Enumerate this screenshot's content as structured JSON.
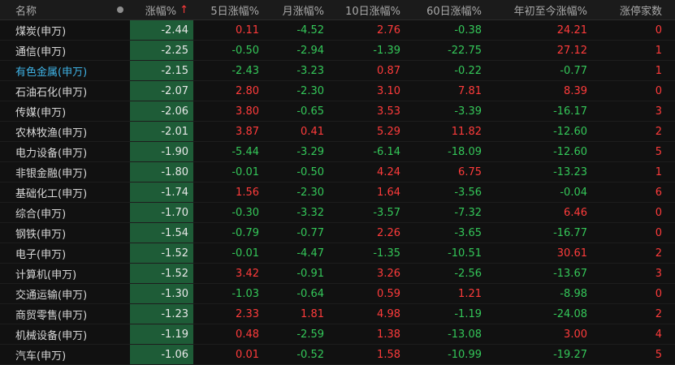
{
  "header": {
    "name": "名称",
    "change": "涨幅%",
    "sort_arrow": "↑",
    "d5": "5日涨幅%",
    "month": "月涨幅%",
    "d10": "10日涨幅%",
    "d60": "60日涨幅%",
    "ytd": "年初至今涨幅%",
    "limit_up": "涨停家数"
  },
  "colors": {
    "up": "#ff3b3b",
    "down": "#34c759",
    "selected_column_bg": "#1e5c37",
    "highlight_name": "#3fb3e6"
  },
  "rows": [
    {
      "name": "煤炭(申万)",
      "change": "-2.44",
      "d5": "0.11",
      "month": "-4.52",
      "d10": "2.76",
      "d60": "-0.38",
      "ytd": "24.21",
      "limit_up": "0"
    },
    {
      "name": "通信(申万)",
      "change": "-2.25",
      "d5": "-0.50",
      "month": "-2.94",
      "d10": "-1.39",
      "d60": "-22.75",
      "ytd": "27.12",
      "limit_up": "1"
    },
    {
      "name": "有色金属(申万)",
      "change": "-2.15",
      "d5": "-2.43",
      "month": "-3.23",
      "d10": "0.87",
      "d60": "-0.22",
      "ytd": "-0.77",
      "limit_up": "1",
      "highlight": true
    },
    {
      "name": "石油石化(申万)",
      "change": "-2.07",
      "d5": "2.80",
      "month": "-2.30",
      "d10": "3.10",
      "d60": "7.81",
      "ytd": "8.39",
      "limit_up": "0"
    },
    {
      "name": "传媒(申万)",
      "change": "-2.06",
      "d5": "3.80",
      "month": "-0.65",
      "d10": "3.53",
      "d60": "-3.39",
      "ytd": "-16.17",
      "limit_up": "3"
    },
    {
      "name": "农林牧渔(申万)",
      "change": "-2.01",
      "d5": "3.87",
      "month": "0.41",
      "d10": "5.29",
      "d60": "11.82",
      "ytd": "-12.60",
      "limit_up": "2"
    },
    {
      "name": "电力设备(申万)",
      "change": "-1.90",
      "d5": "-5.44",
      "month": "-3.29",
      "d10": "-6.14",
      "d60": "-18.09",
      "ytd": "-12.60",
      "limit_up": "5"
    },
    {
      "name": "非银金融(申万)",
      "change": "-1.80",
      "d5": "-0.01",
      "month": "-0.50",
      "d10": "4.24",
      "d60": "6.75",
      "ytd": "-13.23",
      "limit_up": "1"
    },
    {
      "name": "基础化工(申万)",
      "change": "-1.74",
      "d5": "1.56",
      "month": "-2.30",
      "d10": "1.64",
      "d60": "-3.56",
      "ytd": "-0.04",
      "limit_up": "6"
    },
    {
      "name": "综合(申万)",
      "change": "-1.70",
      "d5": "-0.30",
      "month": "-3.32",
      "d10": "-3.57",
      "d60": "-7.32",
      "ytd": "6.46",
      "limit_up": "0"
    },
    {
      "name": "钢铁(申万)",
      "change": "-1.54",
      "d5": "-0.79",
      "month": "-0.77",
      "d10": "2.26",
      "d60": "-3.65",
      "ytd": "-16.77",
      "limit_up": "0"
    },
    {
      "name": "电子(申万)",
      "change": "-1.52",
      "d5": "-0.01",
      "month": "-4.47",
      "d10": "-1.35",
      "d60": "-10.51",
      "ytd": "30.61",
      "limit_up": "2"
    },
    {
      "name": "计算机(申万)",
      "change": "-1.52",
      "d5": "3.42",
      "month": "-0.91",
      "d10": "3.26",
      "d60": "-2.56",
      "ytd": "-13.67",
      "limit_up": "3"
    },
    {
      "name": "交通运输(申万)",
      "change": "-1.30",
      "d5": "-1.03",
      "month": "-0.64",
      "d10": "0.59",
      "d60": "1.21",
      "ytd": "-8.98",
      "limit_up": "0"
    },
    {
      "name": "商贸零售(申万)",
      "change": "-1.23",
      "d5": "2.33",
      "month": "1.81",
      "d10": "4.98",
      "d60": "-1.19",
      "ytd": "-24.08",
      "limit_up": "2"
    },
    {
      "name": "机械设备(申万)",
      "change": "-1.19",
      "d5": "0.48",
      "month": "-2.59",
      "d10": "1.38",
      "d60": "-13.08",
      "ytd": "3.00",
      "limit_up": "4"
    },
    {
      "name": "汽车(申万)",
      "change": "-1.06",
      "d5": "0.01",
      "month": "-0.52",
      "d10": "1.58",
      "d60": "-10.99",
      "ytd": "-19.27",
      "limit_up": "5"
    }
  ]
}
